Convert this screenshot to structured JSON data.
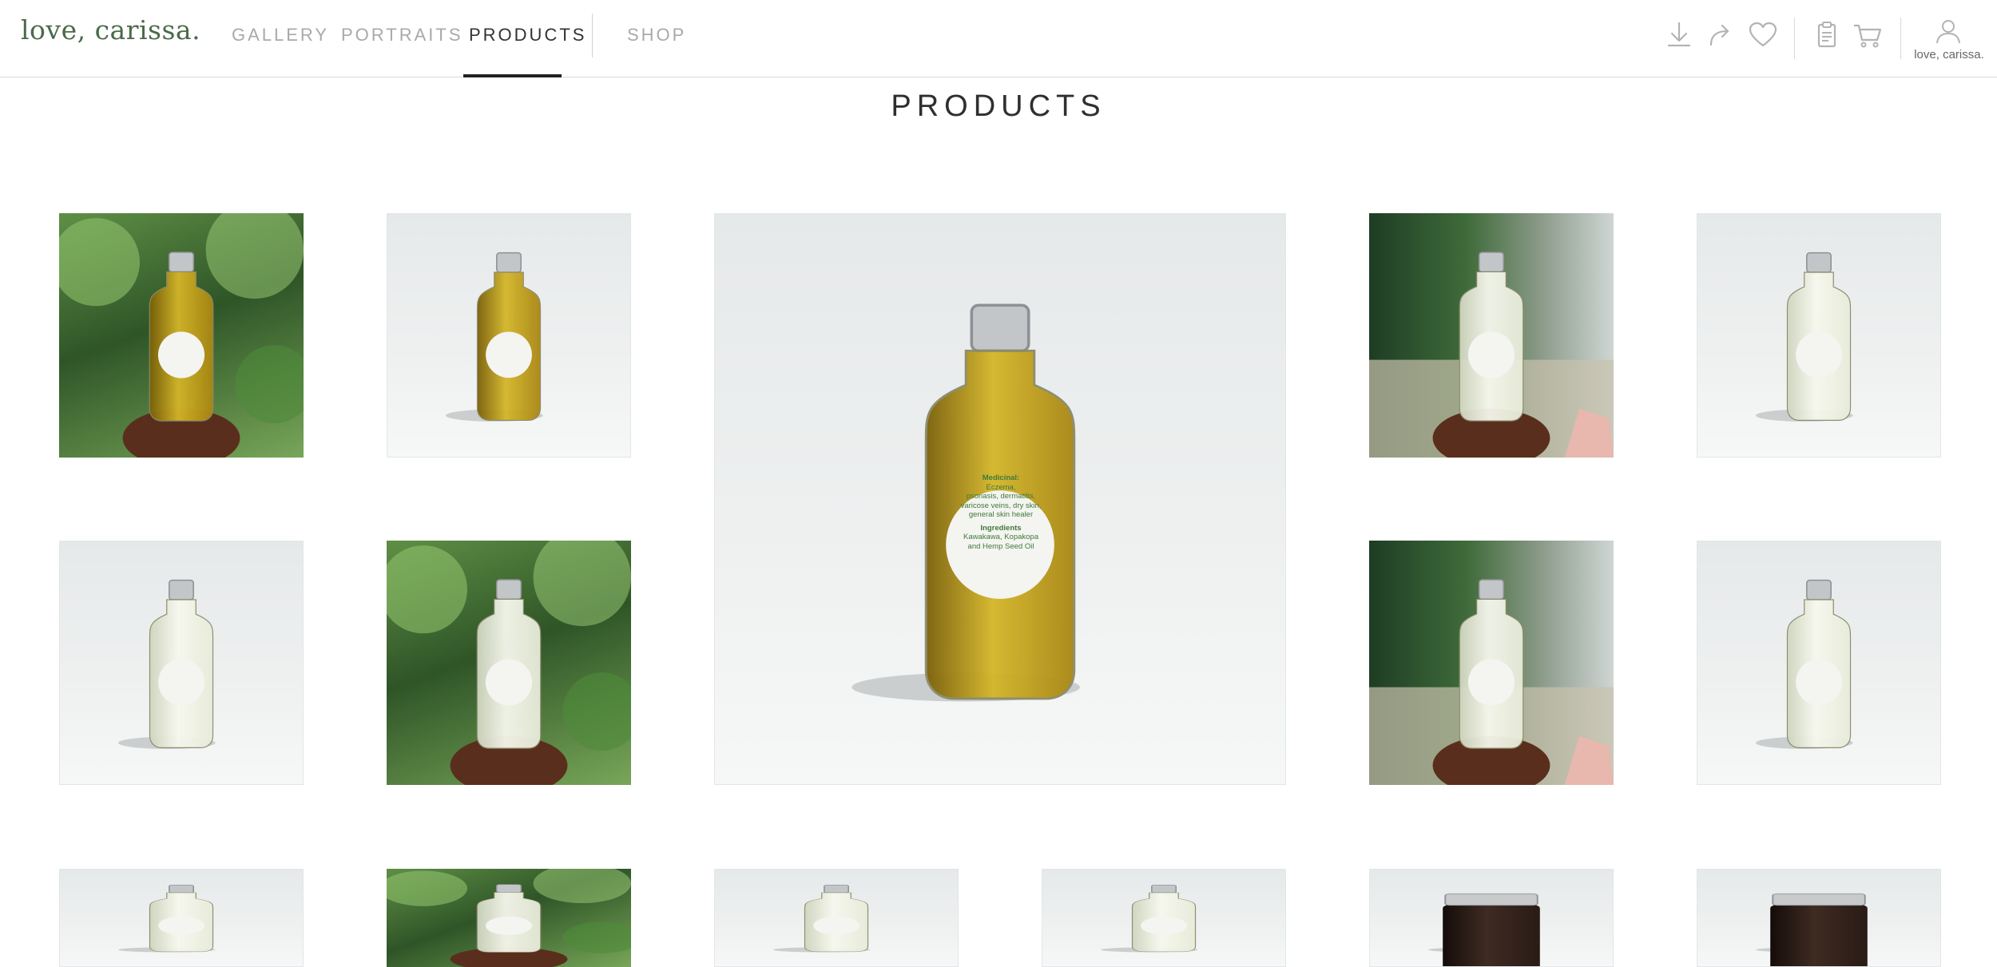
{
  "brand": {
    "name": "love, carissa."
  },
  "nav": {
    "items": [
      {
        "label": "GALLERY",
        "active": false
      },
      {
        "label": "PORTRAITS",
        "active": false
      },
      {
        "label": "PRODUCTS",
        "active": true
      },
      {
        "label": "SHOP",
        "active": false
      }
    ]
  },
  "header_actions": [
    {
      "icon": "download-icon"
    },
    {
      "icon": "share-icon"
    },
    {
      "icon": "heart-icon"
    },
    {
      "icon": "clipboard-icon"
    },
    {
      "icon": "cart-icon"
    }
  ],
  "account": {
    "icon": "user-icon",
    "label": "love, carissa."
  },
  "page": {
    "title": "PRODUCTS"
  },
  "gallery": {
    "featured_label": {
      "medicinal_heading": "Medicinal:",
      "medicinal_lines": [
        "Eczema,",
        "psoriasis, dermatitis,",
        "varicose veins, dry skin,",
        "general skin healer"
      ],
      "ingredients_heading": "Ingredients",
      "ingredients_lines": [
        "Kawakawa, Kopakopa",
        "and Hemp Seed Oil"
      ]
    },
    "tiles": [
      {
        "scene": "garden",
        "liquid": "gold"
      },
      {
        "scene": "studio",
        "liquid": "gold"
      },
      {
        "scene": "studio",
        "liquid": "gold",
        "featured": true
      },
      {
        "scene": "terrace",
        "liquid": "clear"
      },
      {
        "scene": "studio",
        "liquid": "clear"
      },
      {
        "scene": "studio",
        "liquid": "clear"
      },
      {
        "scene": "garden",
        "liquid": "clear"
      },
      {
        "scene": "terrace",
        "liquid": "clear"
      },
      {
        "scene": "studio",
        "liquid": "clear"
      },
      {
        "scene": "studio",
        "liquid": "clear"
      },
      {
        "scene": "garden",
        "liquid": "clear"
      },
      {
        "scene": "studio",
        "liquid": "clear"
      },
      {
        "scene": "studio",
        "liquid": "clear"
      },
      {
        "scene": "studio",
        "liquid": "dark"
      },
      {
        "scene": "studio",
        "liquid": "dark"
      }
    ]
  },
  "colors": {
    "brand_green": "#4a6a4a",
    "nav_inactive": "#a9a9a9",
    "nav_active": "#333333",
    "oil_gold": "#b8960f",
    "label_green": "#3f7a3a"
  }
}
